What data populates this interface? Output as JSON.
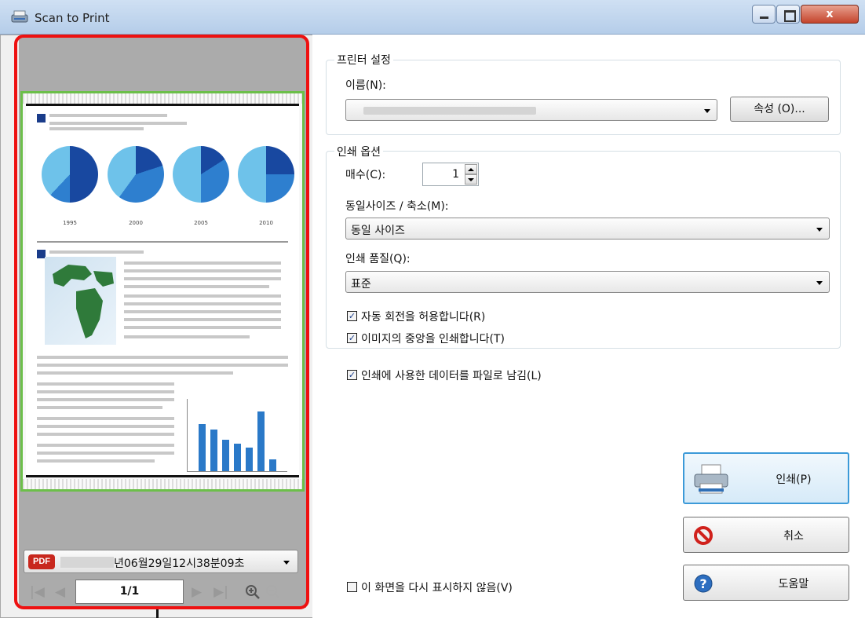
{
  "window": {
    "title": "Scan to Print",
    "close_label": "x"
  },
  "preview": {
    "pie_years": [
      "1995",
      "2000",
      "2005",
      "2010"
    ],
    "file_format_badge": "PDF",
    "file_name": "년06월29일12시38분09초",
    "page_indicator": "1/1"
  },
  "printer_settings": {
    "group_title": "프린터 설정",
    "name_label": "이름(N):",
    "properties_button": "속성 (O)..."
  },
  "print_options": {
    "group_title": "인쇄 옵션",
    "copies_label": "매수(C):",
    "copies_value": "1",
    "scale_label": "동일사이즈 / 축소(M):",
    "scale_value": "동일 사이즈",
    "quality_label": "인쇄 품질(Q):",
    "quality_value": "표준",
    "auto_rotate_label": "자동 회전을 허용합니다(R)",
    "center_label": "이미지의 중앙을 인쇄합니다(T)"
  },
  "keep_data_label": "인쇄에 사용한 데이터를 파일로 남김(L)",
  "dont_show_label": "이 화면을 다시 표시하지 않음(V)",
  "actions": {
    "print_label": "인쇄(P)",
    "cancel_label": "취소",
    "help_label": "도움말"
  }
}
